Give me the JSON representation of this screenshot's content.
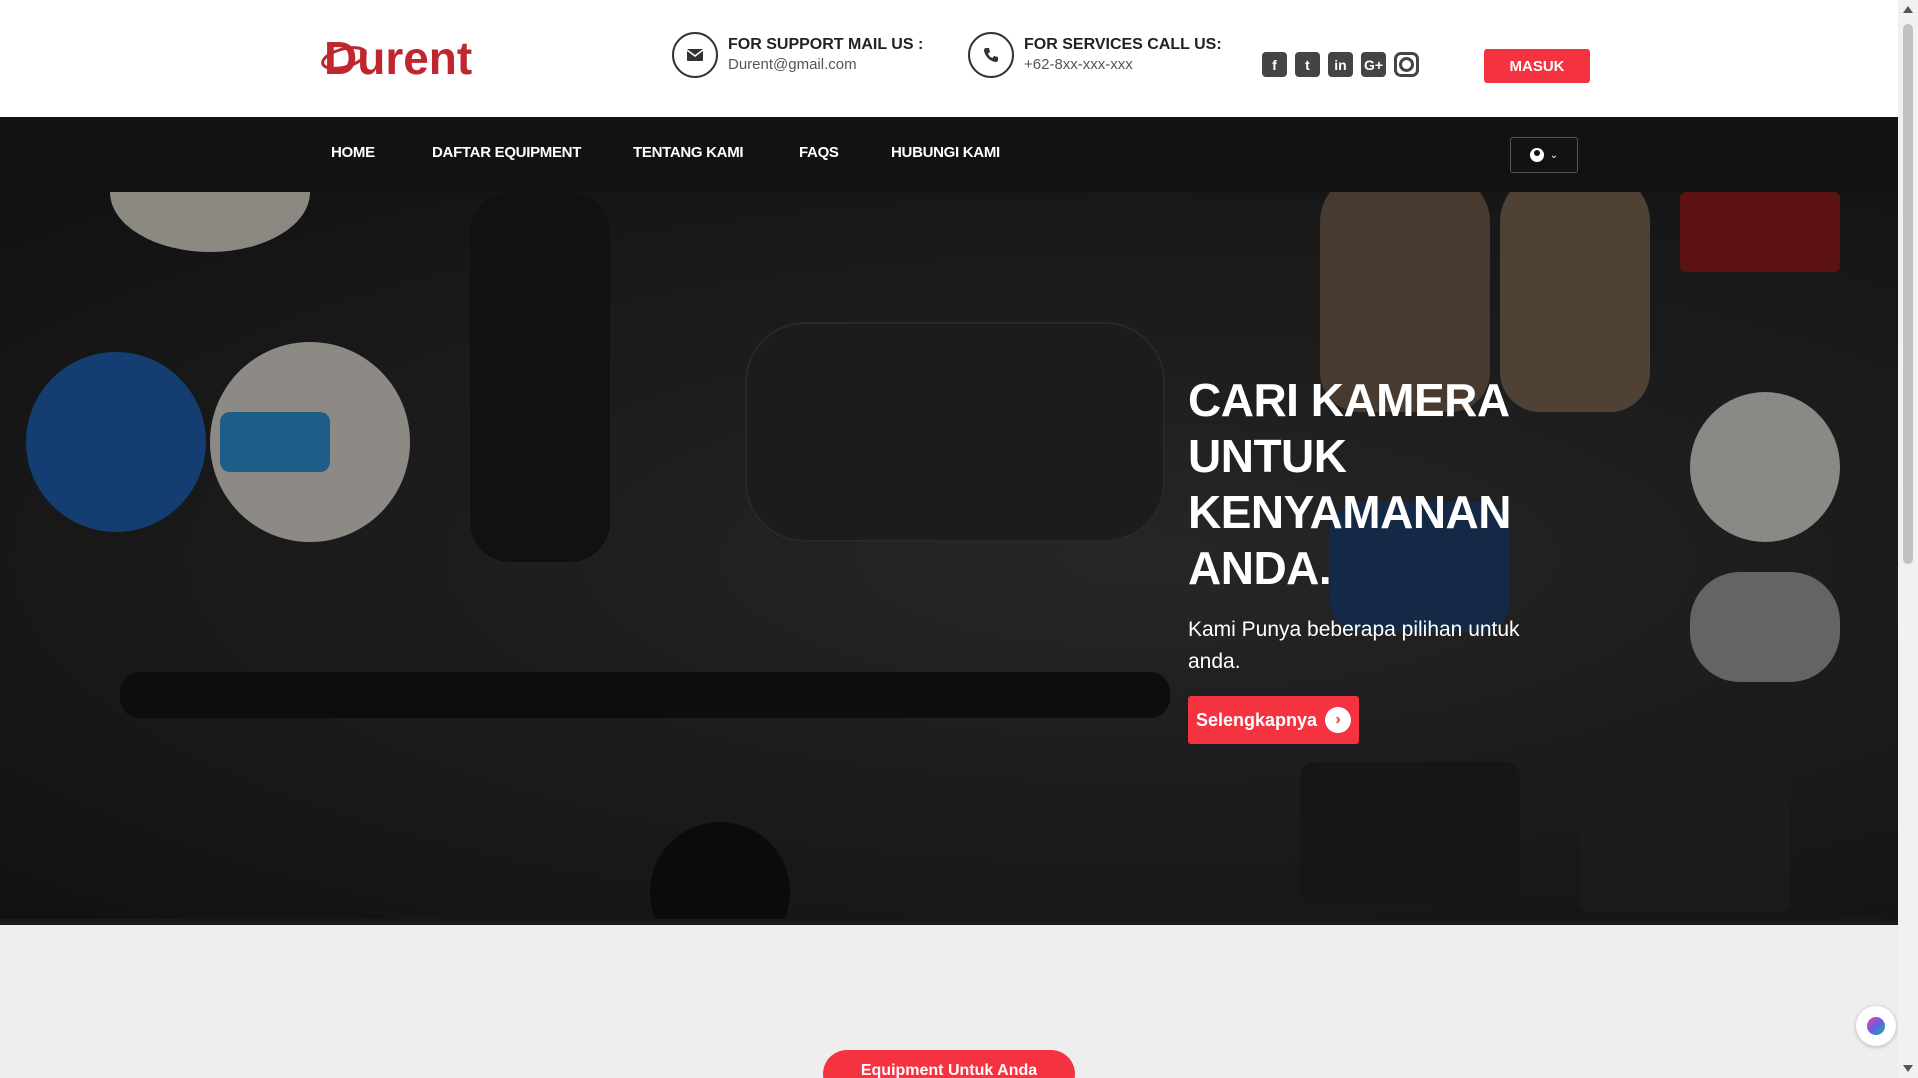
{
  "brand": {
    "logo_text": "Durent",
    "accent": "#f53240",
    "logo_color": "#c0262d"
  },
  "header": {
    "support": {
      "title": "FOR SUPPORT MAIL US :",
      "value": "Durent@gmail.com",
      "icon": "envelope-icon"
    },
    "services": {
      "title": "FOR SERVICES CALL US:",
      "value": "+62-8xx-xxx-xxx",
      "icon": "phone-icon"
    },
    "social": [
      {
        "name": "facebook",
        "glyph": "f"
      },
      {
        "name": "twitter",
        "glyph": "t"
      },
      {
        "name": "linkedin",
        "glyph": "in"
      },
      {
        "name": "google-plus",
        "glyph": "G+"
      },
      {
        "name": "instagram",
        "glyph": ""
      }
    ],
    "login_label": "MASUK"
  },
  "nav": {
    "items": [
      "HOME",
      "DAFTAR EQUIPMENT",
      "TENTANG KAMI",
      "FAQS",
      "HUBUNGI KAMI"
    ],
    "user_icon": "user-circle-icon"
  },
  "hero": {
    "title": "CARI KAMERA UNTUK KENYAMANAN ANDA.",
    "subtitle": "Kami Punya beberapa pilihan untuk anda.",
    "cta_label": "Selengkapnya"
  },
  "section": {
    "pill_label": "Equipment Untuk Anda"
  }
}
